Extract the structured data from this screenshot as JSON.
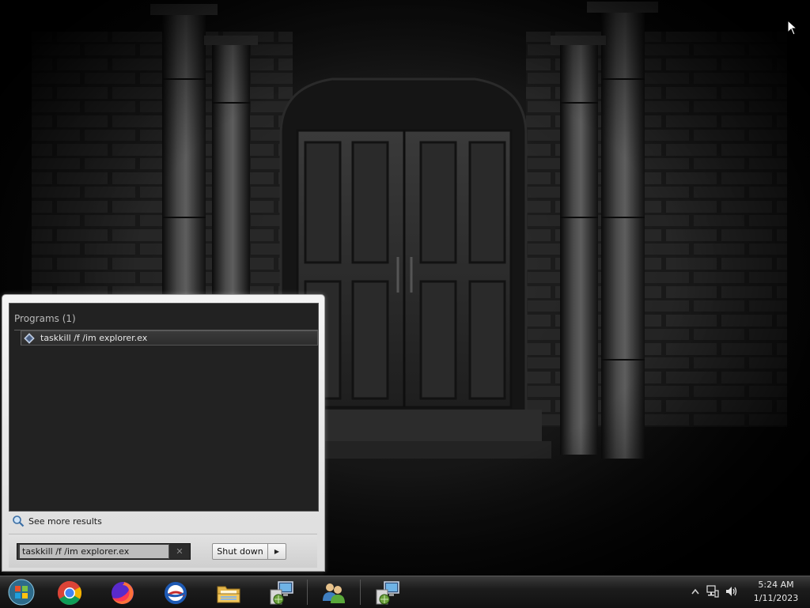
{
  "start_menu": {
    "results_header": "Programs (1)",
    "results": [
      {
        "label": "taskkill /f /im explorer.ex",
        "icon": "command-program-icon"
      }
    ],
    "see_more": "See more results",
    "search": {
      "value": "taskkill /f /im explorer.ex",
      "clear_symbol": "✕"
    },
    "shutdown_label": "Shut down"
  },
  "taskbar": {
    "start_icon": "windows-start-orb-icon",
    "pinned": [
      {
        "name": "chrome-icon"
      },
      {
        "name": "firefox-icon"
      },
      {
        "name": "internet-explorer-icon"
      },
      {
        "name": "file-explorer-icon"
      },
      {
        "name": "network-program-icon"
      },
      {
        "name": "users-icon"
      },
      {
        "name": "network-program-icon-2"
      }
    ],
    "tray": {
      "icons": [
        "show-hidden-icons-chevron",
        "network-icon",
        "volume-icon"
      ],
      "time": "5:24 AM",
      "date": "1/11/2023"
    }
  },
  "desktop": {
    "wallpaper": "dark-castle-doors-wallpaper"
  }
}
